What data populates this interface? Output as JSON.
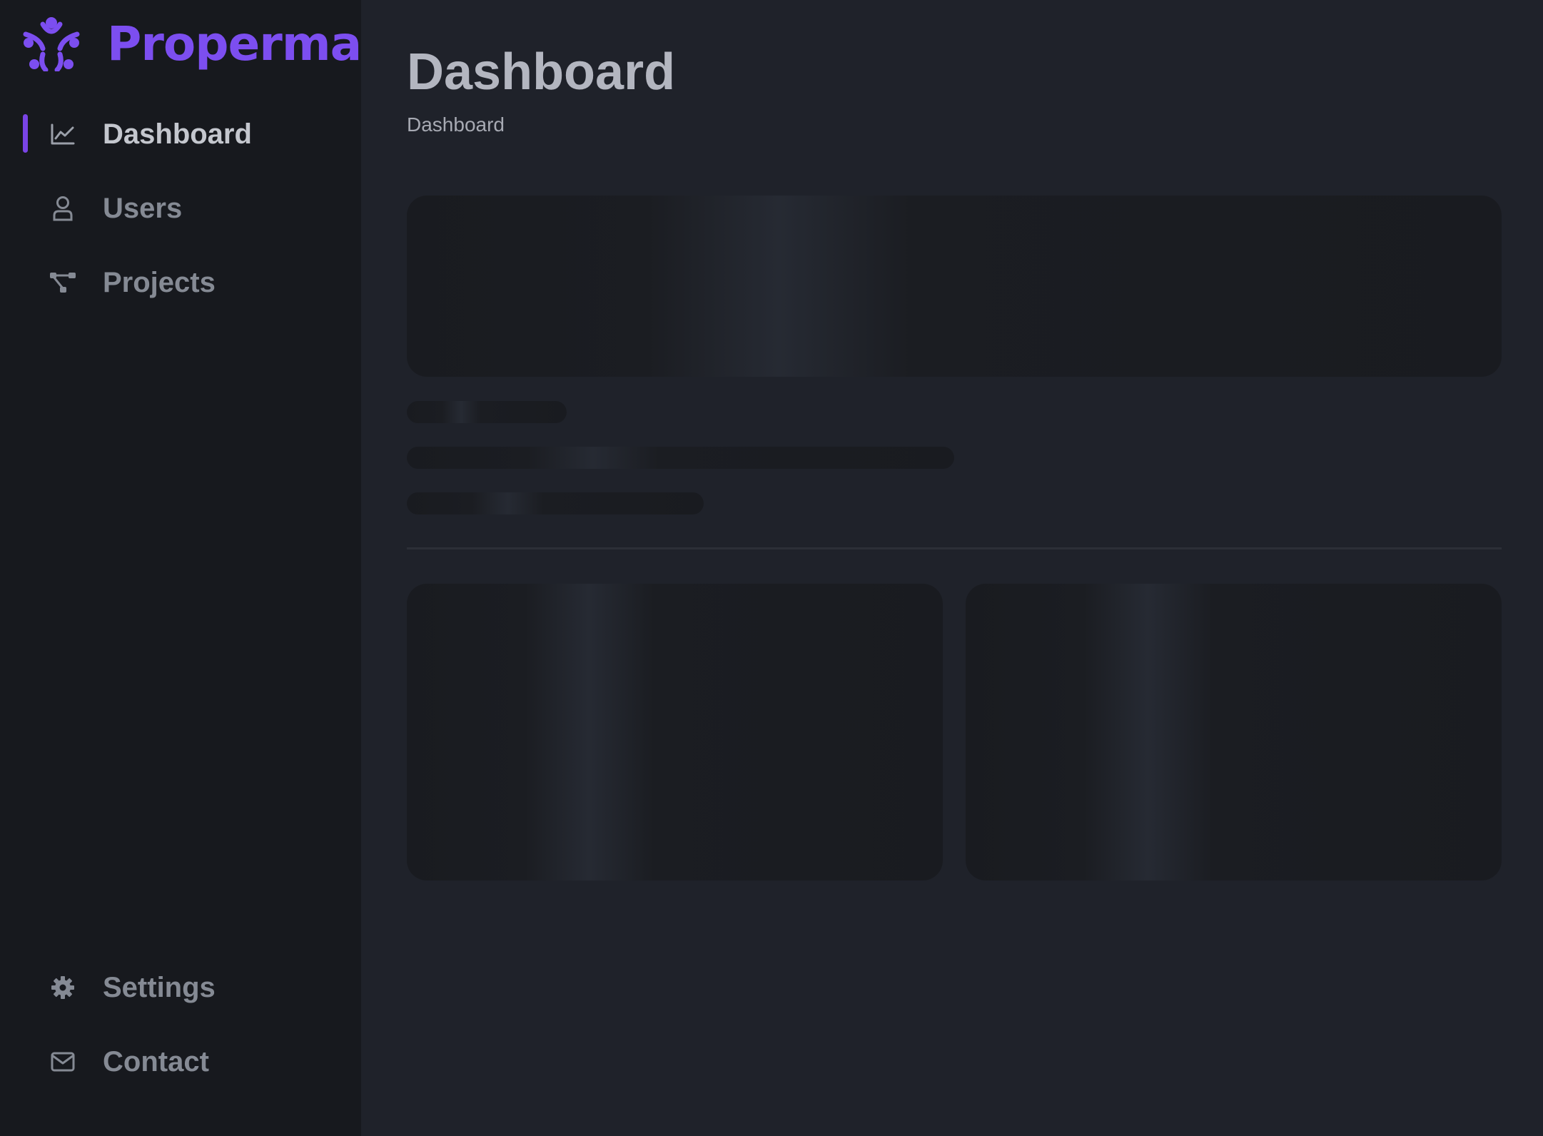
{
  "brand": {
    "name": "Properma",
    "logo_icon": "properma-logo-icon",
    "color": "#7c4ef0"
  },
  "sidebar": {
    "items": [
      {
        "label": "Dashboard",
        "icon": "line-chart-icon",
        "active": true
      },
      {
        "label": "Users",
        "icon": "user-icon",
        "active": false
      },
      {
        "label": "Projects",
        "icon": "hierarchy-icon",
        "active": false
      }
    ],
    "bottom_items": [
      {
        "label": "Settings",
        "icon": "gear-icon"
      },
      {
        "label": "Contact",
        "icon": "envelope-icon"
      }
    ],
    "active_indicator_color": "#7a44e6"
  },
  "main": {
    "title": "Dashboard",
    "breadcrumb": "Dashboard",
    "loading_skeleton": true
  },
  "colors": {
    "background": "#1f222a",
    "sidebar_background": "#17191e"
  }
}
